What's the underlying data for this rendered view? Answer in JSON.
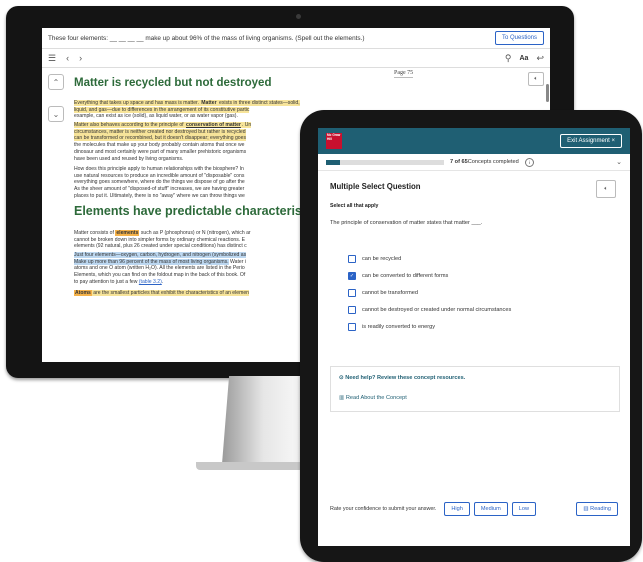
{
  "ebook": {
    "question_text": "These four elements: __ __ __ __ make up about 96% of the mass of living organisms. (Spell out the elements.)",
    "to_questions": "To Questions",
    "page_number": "Page 75",
    "aa_label": "Aa",
    "heading1": "Matter is recycled but not destroyed",
    "p1_a": "Everything that takes up space and has mass is matter. ",
    "p1_kw": "Matter",
    "p1_b": " exists in three distinct states—solid,",
    "p1_c": "liquid, and gas—due to differences in the arrangement of its constitutive partic",
    "p1_d": "example, can exist as ice (solid), as liquid water, or as water vapor (gas).",
    "p2_a": "Matter also behaves according to the principle of ",
    "p2_kw": "conservation of matter",
    "p2_b": ". Un",
    "p2_c": "circumstances, matter is neither created nor destroyed but rather is recycled",
    "p2_d": "can be transformed or recombined, but it doesn't disappear; everything goes",
    "p2_e": "the molecules that make up your body probably contain atoms that once we",
    "p2_f": "dinosaur and most certainly were part of many smaller prehistoric organisms",
    "p2_g": "have been used and reused by living organisms.",
    "p3_a": "How does this principle apply to human relationships with the biosphere? In",
    "p3_b": "use natural resources to produce an incredible amount of \"disposable\" cons",
    "p3_c": "everything goes somewhere, where do the things we dispose of go after the",
    "p3_d": "As the sheer amount of \"disposed-of stuff\" increases, we are having greater",
    "p3_e": "places to put it. Ultimately, there is no \"away\" where we can throw things we",
    "heading2": "Elements have predictable characteristic",
    "p4_a": "Matter consists of ",
    "p4_kw": "elements",
    "p4_b": " such as P (phosphorus) or N (nitrogen), which ar",
    "p4_c": "cannot be broken down into simpler forms by ordinary chemical reactions. E",
    "p4_d": "elements (92 natural, plus 26 created under special conditions) has distinct c",
    "p5_a": "Just four elements—oxygen, carbon, hydrogen, and nitrogen (symbolized as",
    "p5_b": "Make up more than 96 percent of the mass of most living organisms.",
    "p5_c": " Water i",
    "p5_d": "atoms and one O atom (written H₂O). All the elements are listed in the Perio",
    "p5_e": "Elements, which you can find on the foldout map in the back of this book. Of",
    "p5_f": "to pay attention to just a few ",
    "p5_link": "(table 3.2)",
    "p5_g": ".",
    "p6_kw": "Atoms",
    "p6_a": " are the smallest particles that exhibit the characteristics of an elemen"
  },
  "tablet": {
    "logo_text": "Mc Graw Hill",
    "exit_label": "Exit Assignment ×",
    "progress_fraction": 0.12,
    "progress_count": "7 of 65",
    "progress_label": " Concepts completed",
    "info_icon": "i",
    "question_type": "Multiple Select Question",
    "select_all": "Select all that apply",
    "prompt": "The principle of conservation of matter states that matter ___.",
    "options": [
      {
        "label": "can be recycled",
        "checked": false
      },
      {
        "label": "can be converted to different forms",
        "checked": true
      },
      {
        "label": "cannot be transformed",
        "checked": false
      },
      {
        "label": "cannot be destroyed or created under normal circumstances",
        "checked": false
      },
      {
        "label": "is readily converted to energy",
        "checked": false
      }
    ],
    "help_label": "Need help? Review these concept resources.",
    "read_label": "Read About the Concept",
    "rate_label": "Rate your confidence to submit your answer.",
    "high": "High",
    "medium": "Medium",
    "low": "Low",
    "reading": "Reading"
  }
}
